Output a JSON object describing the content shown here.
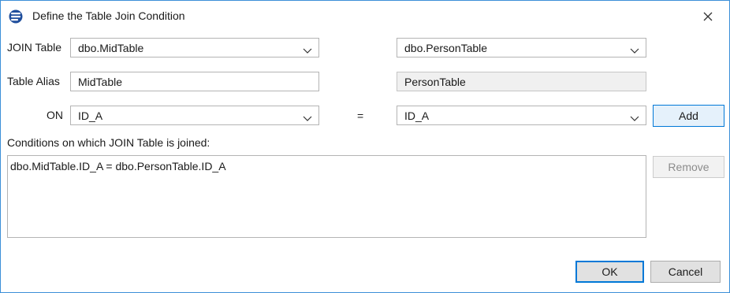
{
  "window": {
    "title": "Define the Table Join Condition",
    "icon": "database-icon",
    "close_icon": "close-icon"
  },
  "join_table": {
    "label": "JOIN Table",
    "left_value": "dbo.MidTable",
    "right_value": "dbo.PersonTable"
  },
  "table_alias": {
    "label": "Table Alias",
    "left_value": "MidTable",
    "right_value": "PersonTable"
  },
  "on_row": {
    "label": "ON",
    "left_value": "ID_A",
    "equals": "=",
    "right_value": "ID_A",
    "add_label": "Add"
  },
  "conditions": {
    "label": "Conditions on which JOIN Table is joined:",
    "items": [
      "dbo.MidTable.ID_A = dbo.PersonTable.ID_A"
    ],
    "remove_label": "Remove"
  },
  "footer": {
    "ok_label": "OK",
    "cancel_label": "Cancel"
  },
  "colors": {
    "accent": "#0078d7",
    "window_border": "#3c8fd8",
    "button_face": "#e1e1e1",
    "readonly_bg": "#f0f0f0"
  }
}
